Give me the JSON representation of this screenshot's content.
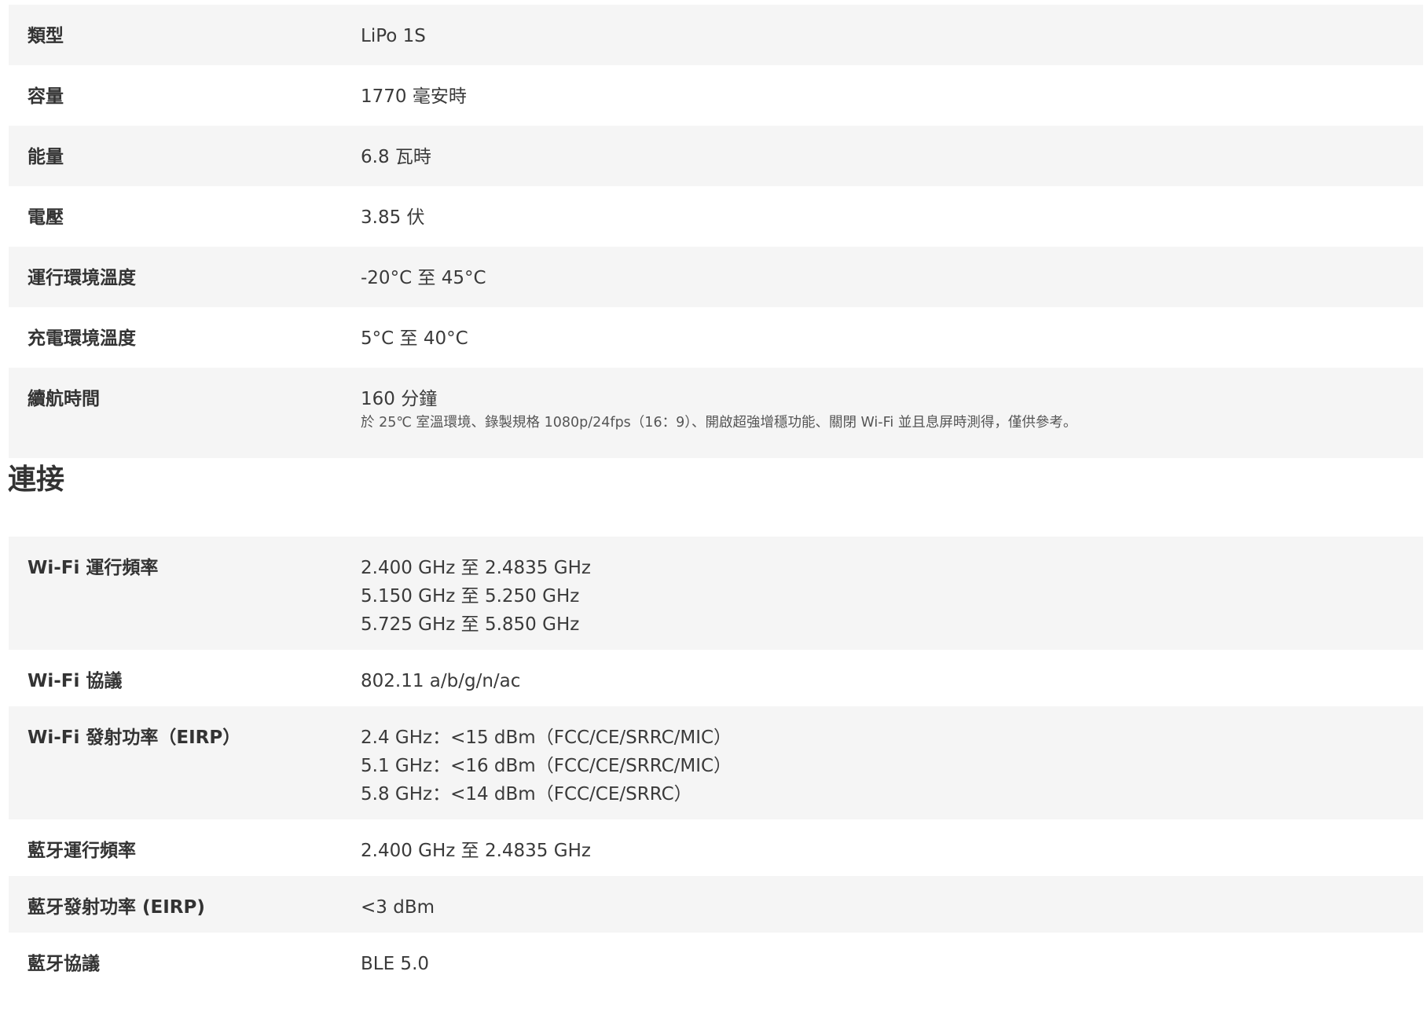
{
  "battery": {
    "rows": [
      {
        "label": "類型",
        "value": "LiPo 1S"
      },
      {
        "label": "容量",
        "value": "1770 毫安時"
      },
      {
        "label": "能量",
        "value": "6.8 瓦時"
      },
      {
        "label": "電壓",
        "value": "3.85 伏"
      },
      {
        "label": "運行環境溫度",
        "value": "-20°C 至 45°C"
      },
      {
        "label": "充電環境溫度",
        "value": "5°C 至 40°C"
      },
      {
        "label": "續航時間",
        "value": "160 分鐘",
        "note": "於 25℃ 室溫環境、錄製規格 1080p/24fps（16：9）、開啟超強增穩功能、關閉 Wi-Fi 並且息屏時測得，僅供參考。"
      }
    ]
  },
  "connectivity": {
    "title": "連接",
    "rows": [
      {
        "label": "Wi-Fi 運行頻率",
        "lines": [
          "2.400 GHz 至 2.4835 GHz",
          "5.150 GHz 至 5.250 GHz",
          "5.725 GHz 至 5.850 GHz"
        ]
      },
      {
        "label": "Wi-Fi 協議",
        "lines": [
          "802.11 a/b/g/n/ac"
        ]
      },
      {
        "label": "Wi-Fi 發射功率（EIRP）",
        "lines": [
          "2.4 GHz：<15 dBm（FCC/CE/SRRC/MIC）",
          "5.1 GHz：<16 dBm（FCC/CE/SRRC/MIC）",
          "5.8 GHz：<14 dBm（FCC/CE/SRRC）"
        ]
      },
      {
        "label": "藍牙運行頻率",
        "lines": [
          "2.400 GHz 至 2.4835 GHz"
        ]
      },
      {
        "label": "藍牙發射功率 (EIRP)",
        "lines": [
          "<3 dBm"
        ]
      },
      {
        "label": "藍牙協議",
        "lines": [
          "BLE 5.0"
        ]
      }
    ]
  }
}
